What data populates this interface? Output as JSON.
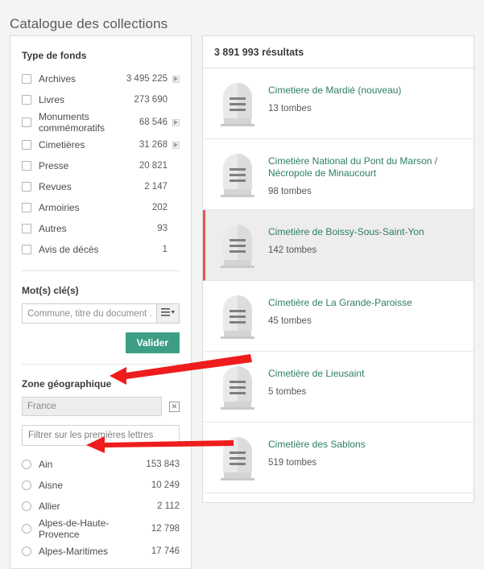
{
  "page": {
    "title": "Catalogue des collections"
  },
  "sidebar": {
    "fonds": {
      "heading": "Type de fonds",
      "items": [
        {
          "label": "Archives",
          "count": "3 495 225",
          "expandable": true
        },
        {
          "label": "Livres",
          "count": "273 690",
          "expandable": false
        },
        {
          "label": "Monuments commémoratifs",
          "count": "68 546",
          "expandable": true
        },
        {
          "label": "Cimetières",
          "count": "31 268",
          "expandable": true
        },
        {
          "label": "Presse",
          "count": "20 821",
          "expandable": false
        },
        {
          "label": "Revues",
          "count": "2 147",
          "expandable": false
        },
        {
          "label": "Armoiries",
          "count": "202",
          "expandable": false
        },
        {
          "label": "Autres",
          "count": "93",
          "expandable": false
        },
        {
          "label": "Avis de décès",
          "count": "1",
          "expandable": false
        }
      ]
    },
    "keywords": {
      "heading": "Mot(s) clé(s)",
      "input_placeholder": "Commune, titre du document ...",
      "input_value": "",
      "dropdown_icon": "list-chevron-down-icon",
      "submit_label": "Valider"
    },
    "geo": {
      "heading": "Zone géographique",
      "selected_value": "France",
      "clear_icon": "close-box-icon",
      "filter_placeholder": "Filtrer sur les premières lettres",
      "filter_value": "",
      "items": [
        {
          "label": "Ain",
          "count": "153 843"
        },
        {
          "label": "Aisne",
          "count": "10 249"
        },
        {
          "label": "Allier",
          "count": "2 112"
        },
        {
          "label": "Alpes-de-Haute-Provence",
          "count": "12 798"
        },
        {
          "label": "Alpes-Maritimes",
          "count": "17 746"
        }
      ]
    }
  },
  "results": {
    "count_label": "3 891 993 résultats",
    "items": [
      {
        "title": "Cimetiere de Mardié (nouveau)",
        "subtitle": "13 tombes",
        "selected": false
      },
      {
        "title": "Cimetière National du Pont du Marson / Nécropole de Minaucourt",
        "subtitle": "98 tombes",
        "selected": false
      },
      {
        "title": "Cimetière de Boissy-Sous-Saint-Yon",
        "subtitle": "142 tombes",
        "selected": true
      },
      {
        "title": "Cimetière de La Grande-Paroisse",
        "subtitle": "45 tombes",
        "selected": false
      },
      {
        "title": "Cimetière de Lieusaint",
        "subtitle": "5 tombes",
        "selected": false
      },
      {
        "title": "Cimetière des Sablons",
        "subtitle": "519 tombes",
        "selected": false
      }
    ]
  },
  "annotations": {
    "arrow_color": "#ee1c1c",
    "arrows": [
      {
        "name": "arrow-to-geographic-zone-field"
      },
      {
        "name": "arrow-to-aisne-option"
      }
    ]
  },
  "colors": {
    "accent_green": "#3d9e85",
    "link_green": "#2d7d68",
    "selected_marker": "#e2574c"
  }
}
